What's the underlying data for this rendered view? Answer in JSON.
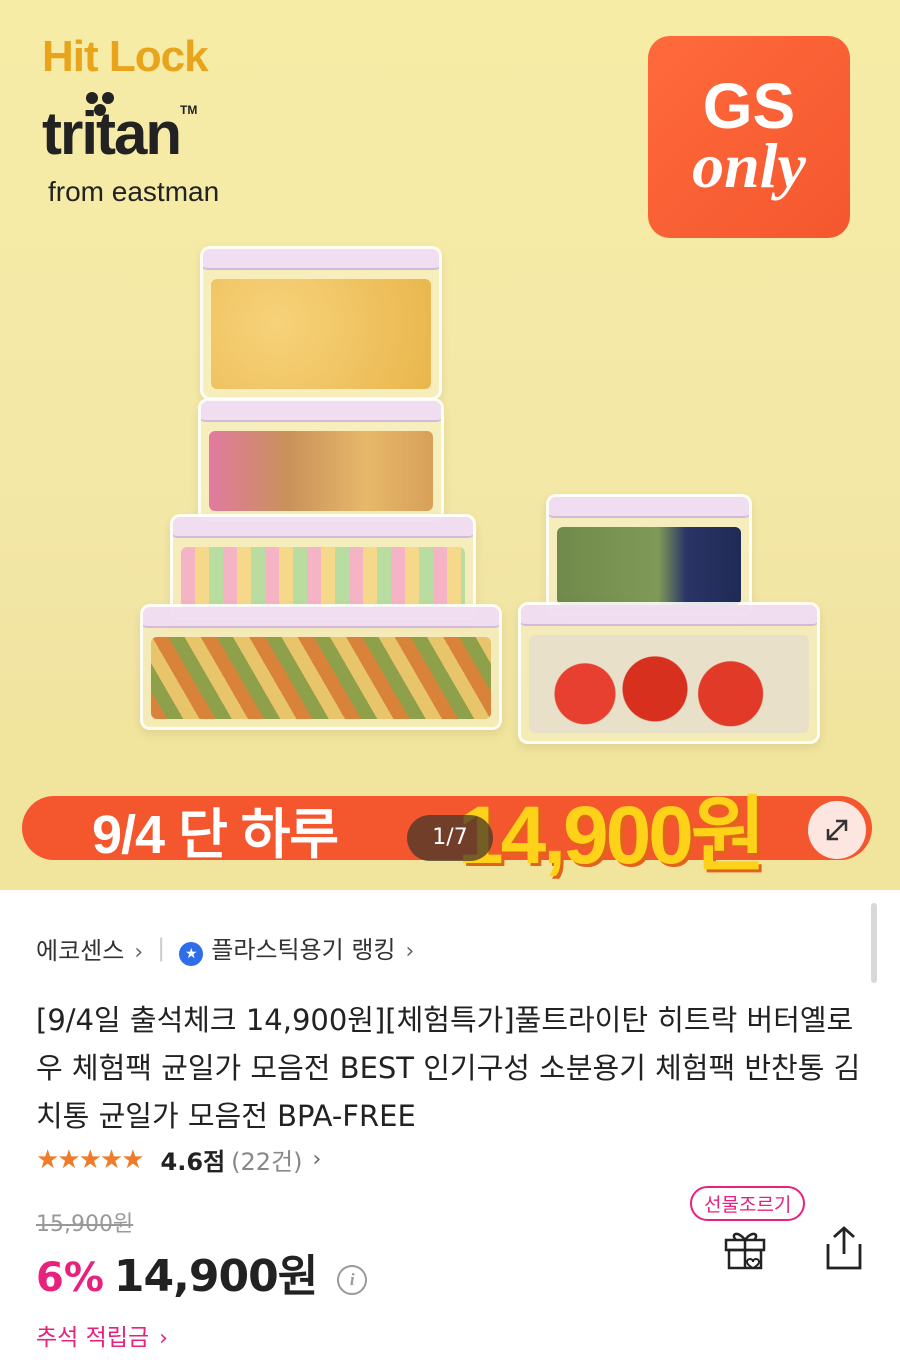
{
  "banner": {
    "brand_top": "Hit Lock",
    "brand_name": "tritan",
    "brand_tm": "TM",
    "brand_sub": "from eastman",
    "badge_line1": "GS",
    "badge_line2": "only",
    "promo_left": "9/4 단 하루",
    "promo_price": "14,900원",
    "counter": "1/7",
    "colors": {
      "promo_bar": "#f4562e",
      "promo_price": "#ffd21a",
      "badge": "#f4572e",
      "brand_top": "#e8a41a"
    }
  },
  "breadcrumb": {
    "seller": "에코센스",
    "ranking": "플라스틱용기 랭킹"
  },
  "product": {
    "title": "[9/4일 출석체크 14,900원][체험특가]풀트라이탄 히트락 버터옐로우 체험팩 균일가 모음전 BEST 인기구성 소분용기 체험팩 반찬통 김치통 균일가 모음전 BPA-FREE",
    "rating": {
      "stars": 4.6,
      "score_text": "4.6점",
      "count_text": "(22건)"
    },
    "original_price": "15,900원",
    "discount": "6%",
    "price": "14,900원",
    "gift_label": "선물조르기",
    "points_label": "추석 적립금"
  },
  "icons": {
    "info": "info-icon",
    "gift": "gift-icon",
    "share": "share-icon",
    "expand": "expand-icon",
    "medal": "medal-icon"
  },
  "accent_color": "#e8217d"
}
